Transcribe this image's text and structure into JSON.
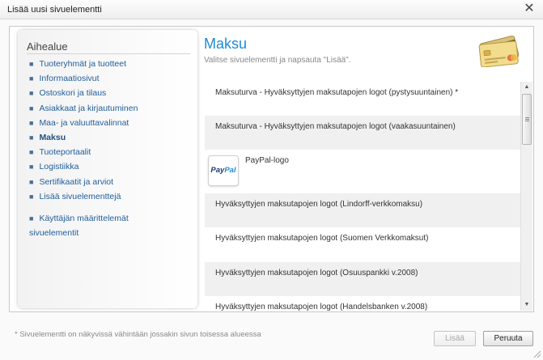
{
  "dialog": {
    "title": "Lisää uusi sivuelementti",
    "close_label": "✕"
  },
  "sidebar": {
    "heading": "Aihealue",
    "items": [
      {
        "label": "Tuoteryhmät ja tuotteet",
        "active": false
      },
      {
        "label": "Informaatiosivut",
        "active": false
      },
      {
        "label": "Ostoskori ja tilaus",
        "active": false
      },
      {
        "label": "Asiakkaat ja kirjautuminen",
        "active": false
      },
      {
        "label": "Maa- ja valuuttavalinnat",
        "active": false
      },
      {
        "label": "Maksu",
        "active": true
      },
      {
        "label": "Tuoteportaalit",
        "active": false
      },
      {
        "label": "Logistiikka",
        "active": false
      },
      {
        "label": "Sertifikaatit ja arviot",
        "active": false
      },
      {
        "label": "Lisää sivuelementtejä",
        "active": false
      }
    ],
    "custom_item": {
      "line1": "Käyttäjän määrittelemät",
      "line2": "sivuelementit"
    }
  },
  "content": {
    "title": "Maksu",
    "subtitle": "Valitse sivuelementti ja napsauta \"Lisää\".",
    "items": [
      {
        "label": "Maksuturva - Hyväksyttyjen maksutapojen logot (pystysuuntainen) *"
      },
      {
        "label": "Maksuturva - Hyväksyttyjen maksutapojen logot (vaakasuuntainen)"
      },
      {
        "label": "PayPal-logo",
        "logo_text_1": "Pay",
        "logo_text_2": "Pal"
      },
      {
        "label": "Hyväksyttyjen maksutapojen logot (Lindorff-verkkomaksu)"
      },
      {
        "label": "Hyväksyttyjen maksutapojen logot (Suomen Verkkomaksut)"
      },
      {
        "label": "Hyväksyttyjen maksutapojen logot (Osuuspankki v.2008)"
      },
      {
        "label": "Hyväksyttyjen maksutapojen logot (Handelsbanken v.2008)"
      }
    ]
  },
  "footer": {
    "note": "* Sivuelementti on näkyvissä vähintään jossakin sivun toisessa alueessa",
    "add_label": "Lisää",
    "add_disabled": true,
    "cancel_label": "Peruuta"
  },
  "colors": {
    "title_blue": "#1d8bd6",
    "link_blue": "#1f5d9c",
    "alt_row": "#f0f0f0"
  },
  "icons": {
    "header_illustration": "credit-cards-icon",
    "close": "close-icon"
  }
}
